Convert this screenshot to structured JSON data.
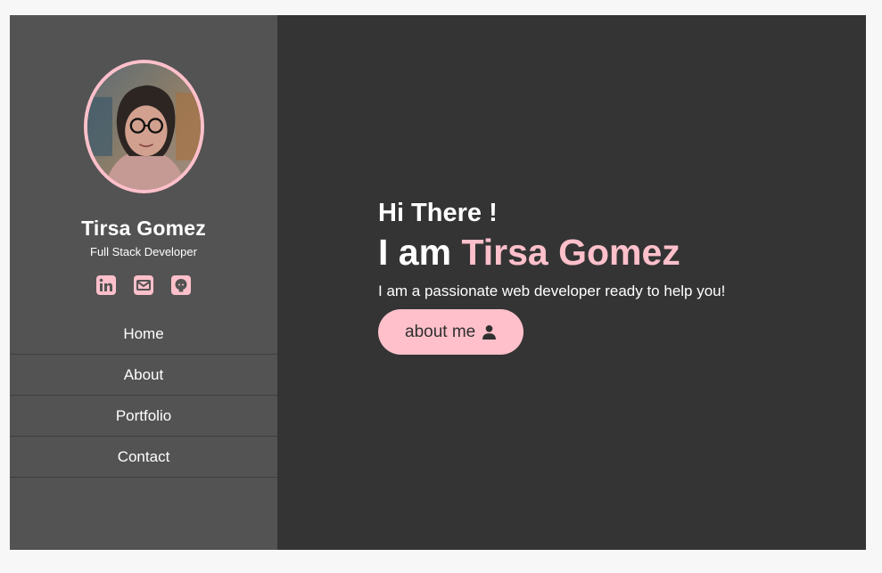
{
  "profile": {
    "name": "Tirsa Gomez",
    "role": "Full Stack Developer"
  },
  "socials": [
    {
      "icon": "linkedin-icon"
    },
    {
      "icon": "envelope-icon"
    },
    {
      "icon": "github-icon"
    }
  ],
  "nav": {
    "items": [
      "Home",
      "About",
      "Portfolio",
      "Contact"
    ]
  },
  "hero": {
    "greeting": "Hi There !",
    "intro_prefix": "I am",
    "intro_name": "Tirsa Gomez",
    "tagline": "I am a passionate web developer ready to help you!",
    "button_label": "about me",
    "button_icon": "user-icon"
  },
  "colors": {
    "accent": "#ffc0cb",
    "sidebar_bg": "#535353",
    "main_bg": "#343434",
    "page_bg": "#f7f7f7"
  }
}
